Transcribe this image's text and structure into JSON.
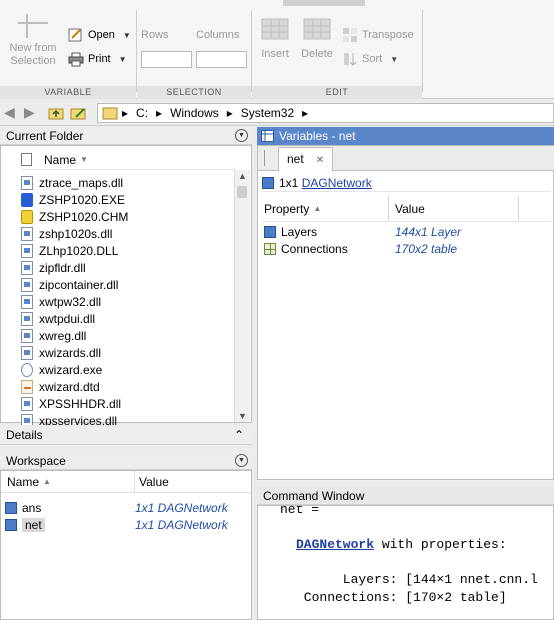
{
  "toolstrip": {
    "variable": {
      "new_from_selection": "New from\nSelection",
      "open": "Open",
      "print": "Print",
      "label": "VARIABLE"
    },
    "selection": {
      "rows": "Rows",
      "columns": "Columns",
      "label": "SELECTION"
    },
    "edit": {
      "insert": "Insert",
      "delete": "Delete",
      "transpose": "Transpose",
      "sort": "Sort",
      "label": "EDIT"
    }
  },
  "address": {
    "path": [
      "C:",
      "Windows",
      "System32"
    ]
  },
  "current_folder": {
    "title": "Current Folder",
    "column": "Name",
    "files": [
      {
        "name": "ztrace_maps.dll",
        "icon": "dll"
      },
      {
        "name": "ZSHP1020.EXE",
        "icon": "exe"
      },
      {
        "name": "ZSHP1020.CHM",
        "icon": "chm"
      },
      {
        "name": "zshp1020s.dll",
        "icon": "dll"
      },
      {
        "name": "ZLhp1020.DLL",
        "icon": "dll"
      },
      {
        "name": "zipfldr.dll",
        "icon": "dll"
      },
      {
        "name": "zipcontainer.dll",
        "icon": "dll"
      },
      {
        "name": "xwtpw32.dll",
        "icon": "dll"
      },
      {
        "name": "xwtpdui.dll",
        "icon": "dll"
      },
      {
        "name": "xwreg.dll",
        "icon": "dll"
      },
      {
        "name": "xwizards.dll",
        "icon": "dll"
      },
      {
        "name": "xwizard.exe",
        "icon": "exe2"
      },
      {
        "name": "xwizard.dtd",
        "icon": "dtd"
      },
      {
        "name": "XPSSHHDR.dll",
        "icon": "dll"
      },
      {
        "name": "xpsservices.dll",
        "icon": "dll"
      }
    ]
  },
  "details": {
    "title": "Details"
  },
  "workspace": {
    "title": "Workspace",
    "col_name": "Name",
    "col_value": "Value",
    "rows": [
      {
        "name": "ans",
        "value": "1x1 DAGNetwork"
      },
      {
        "name": "net",
        "value": "1x1 DAGNetwork"
      }
    ]
  },
  "variables": {
    "title": "Variables - net",
    "tab": "net",
    "summary_size": "1x1",
    "summary_class": "DAGNetwork",
    "col_property": "Property",
    "col_value": "Value",
    "rows": [
      {
        "property": "Layers",
        "value": "144x1 Layer"
      },
      {
        "property": "Connections",
        "value": "170x2 table"
      }
    ]
  },
  "command_window": {
    "title": "Command Window",
    "line1": "net =",
    "link": "DAGNetwork",
    "line2_rest": " with properties:",
    "line3": "      Layers: [144×1 nnet.cnn.l",
    "line4": " Connections: [170×2 table]"
  }
}
